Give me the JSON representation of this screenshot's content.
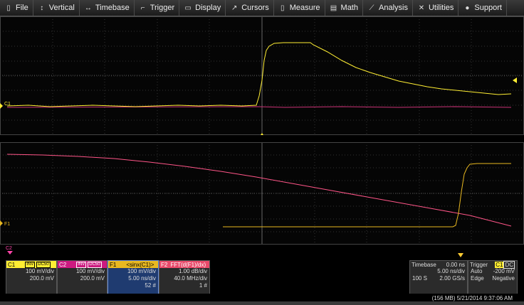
{
  "menu": [
    {
      "label": "File",
      "icon": "file-icon"
    },
    {
      "label": "Vertical",
      "icon": "vertical-arrow-icon"
    },
    {
      "label": "Timebase",
      "icon": "horizontal-arrow-icon"
    },
    {
      "label": "Trigger",
      "icon": "trigger-icon"
    },
    {
      "label": "Display",
      "icon": "display-icon"
    },
    {
      "label": "Cursors",
      "icon": "cursor-icon"
    },
    {
      "label": "Measure",
      "icon": "measure-icon"
    },
    {
      "label": "Math",
      "icon": "math-icon"
    },
    {
      "label": "Analysis",
      "icon": "chart-icon"
    },
    {
      "label": "Utilities",
      "icon": "tools-icon"
    },
    {
      "label": "Support",
      "icon": "info-icon"
    }
  ],
  "traces": {
    "c1_marker": "C1",
    "f1_marker": "F1",
    "c2_marker": "C2"
  },
  "channels": [
    {
      "name": "C1",
      "badge1": "INV",
      "badge2": "DC50",
      "vdiv": "100 mV/div",
      "offset": "200.0 mV",
      "color": "#ffee33"
    },
    {
      "name": "C2",
      "badge1": "INV",
      "badge2": "DC50",
      "vdiv": "100 mV/div",
      "offset": "200.0 mV",
      "color": "#ff44aa"
    },
    {
      "name": "F1",
      "formula": "<sinx(C1)>",
      "vdiv": "100 mV/div",
      "tdiv": "5.00 ns/div",
      "count": "52 #",
      "color": "#ffcc33"
    },
    {
      "name": "F2",
      "formula": "FFT(d(F1)/dx)",
      "vdiv": "1.00 dB/div",
      "tdiv": "40.0 MHz/div",
      "count": "1 #",
      "color": "#ff5577"
    }
  ],
  "timebase": {
    "label": "Timebase",
    "delay": "0.00 ns",
    "tdiv": "5.00 ns/div",
    "samples": "100 S",
    "rate": "2.00 GS/s"
  },
  "trigger": {
    "label": "Trigger",
    "channel": "C1",
    "coupling": "DC",
    "mode": "Auto",
    "level": "-200 mV",
    "type": "Edge",
    "slope": "Negative"
  },
  "status": "(156 MB) 5/21/2014 9:37:06 AM",
  "colors": {
    "c1": "#ffee33",
    "c2": "#ff44aa",
    "f1": "#e8b820",
    "f2": "#ff5588"
  }
}
